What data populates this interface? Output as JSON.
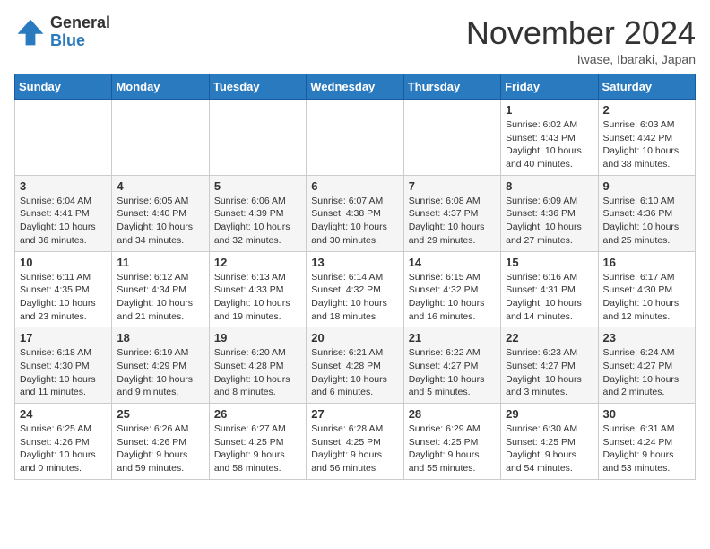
{
  "logo": {
    "general": "General",
    "blue": "Blue"
  },
  "header": {
    "month": "November 2024",
    "location": "Iwase, Ibaraki, Japan"
  },
  "weekdays": [
    "Sunday",
    "Monday",
    "Tuesday",
    "Wednesday",
    "Thursday",
    "Friday",
    "Saturday"
  ],
  "weeks": [
    [
      {
        "day": "",
        "info": ""
      },
      {
        "day": "",
        "info": ""
      },
      {
        "day": "",
        "info": ""
      },
      {
        "day": "",
        "info": ""
      },
      {
        "day": "",
        "info": ""
      },
      {
        "day": "1",
        "info": "Sunrise: 6:02 AM\nSunset: 4:43 PM\nDaylight: 10 hours and 40 minutes."
      },
      {
        "day": "2",
        "info": "Sunrise: 6:03 AM\nSunset: 4:42 PM\nDaylight: 10 hours and 38 minutes."
      }
    ],
    [
      {
        "day": "3",
        "info": "Sunrise: 6:04 AM\nSunset: 4:41 PM\nDaylight: 10 hours and 36 minutes."
      },
      {
        "day": "4",
        "info": "Sunrise: 6:05 AM\nSunset: 4:40 PM\nDaylight: 10 hours and 34 minutes."
      },
      {
        "day": "5",
        "info": "Sunrise: 6:06 AM\nSunset: 4:39 PM\nDaylight: 10 hours and 32 minutes."
      },
      {
        "day": "6",
        "info": "Sunrise: 6:07 AM\nSunset: 4:38 PM\nDaylight: 10 hours and 30 minutes."
      },
      {
        "day": "7",
        "info": "Sunrise: 6:08 AM\nSunset: 4:37 PM\nDaylight: 10 hours and 29 minutes."
      },
      {
        "day": "8",
        "info": "Sunrise: 6:09 AM\nSunset: 4:36 PM\nDaylight: 10 hours and 27 minutes."
      },
      {
        "day": "9",
        "info": "Sunrise: 6:10 AM\nSunset: 4:36 PM\nDaylight: 10 hours and 25 minutes."
      }
    ],
    [
      {
        "day": "10",
        "info": "Sunrise: 6:11 AM\nSunset: 4:35 PM\nDaylight: 10 hours and 23 minutes."
      },
      {
        "day": "11",
        "info": "Sunrise: 6:12 AM\nSunset: 4:34 PM\nDaylight: 10 hours and 21 minutes."
      },
      {
        "day": "12",
        "info": "Sunrise: 6:13 AM\nSunset: 4:33 PM\nDaylight: 10 hours and 19 minutes."
      },
      {
        "day": "13",
        "info": "Sunrise: 6:14 AM\nSunset: 4:32 PM\nDaylight: 10 hours and 18 minutes."
      },
      {
        "day": "14",
        "info": "Sunrise: 6:15 AM\nSunset: 4:32 PM\nDaylight: 10 hours and 16 minutes."
      },
      {
        "day": "15",
        "info": "Sunrise: 6:16 AM\nSunset: 4:31 PM\nDaylight: 10 hours and 14 minutes."
      },
      {
        "day": "16",
        "info": "Sunrise: 6:17 AM\nSunset: 4:30 PM\nDaylight: 10 hours and 12 minutes."
      }
    ],
    [
      {
        "day": "17",
        "info": "Sunrise: 6:18 AM\nSunset: 4:30 PM\nDaylight: 10 hours and 11 minutes."
      },
      {
        "day": "18",
        "info": "Sunrise: 6:19 AM\nSunset: 4:29 PM\nDaylight: 10 hours and 9 minutes."
      },
      {
        "day": "19",
        "info": "Sunrise: 6:20 AM\nSunset: 4:28 PM\nDaylight: 10 hours and 8 minutes."
      },
      {
        "day": "20",
        "info": "Sunrise: 6:21 AM\nSunset: 4:28 PM\nDaylight: 10 hours and 6 minutes."
      },
      {
        "day": "21",
        "info": "Sunrise: 6:22 AM\nSunset: 4:27 PM\nDaylight: 10 hours and 5 minutes."
      },
      {
        "day": "22",
        "info": "Sunrise: 6:23 AM\nSunset: 4:27 PM\nDaylight: 10 hours and 3 minutes."
      },
      {
        "day": "23",
        "info": "Sunrise: 6:24 AM\nSunset: 4:27 PM\nDaylight: 10 hours and 2 minutes."
      }
    ],
    [
      {
        "day": "24",
        "info": "Sunrise: 6:25 AM\nSunset: 4:26 PM\nDaylight: 10 hours and 0 minutes."
      },
      {
        "day": "25",
        "info": "Sunrise: 6:26 AM\nSunset: 4:26 PM\nDaylight: 9 hours and 59 minutes."
      },
      {
        "day": "26",
        "info": "Sunrise: 6:27 AM\nSunset: 4:25 PM\nDaylight: 9 hours and 58 minutes."
      },
      {
        "day": "27",
        "info": "Sunrise: 6:28 AM\nSunset: 4:25 PM\nDaylight: 9 hours and 56 minutes."
      },
      {
        "day": "28",
        "info": "Sunrise: 6:29 AM\nSunset: 4:25 PM\nDaylight: 9 hours and 55 minutes."
      },
      {
        "day": "29",
        "info": "Sunrise: 6:30 AM\nSunset: 4:25 PM\nDaylight: 9 hours and 54 minutes."
      },
      {
        "day": "30",
        "info": "Sunrise: 6:31 AM\nSunset: 4:24 PM\nDaylight: 9 hours and 53 minutes."
      }
    ]
  ]
}
